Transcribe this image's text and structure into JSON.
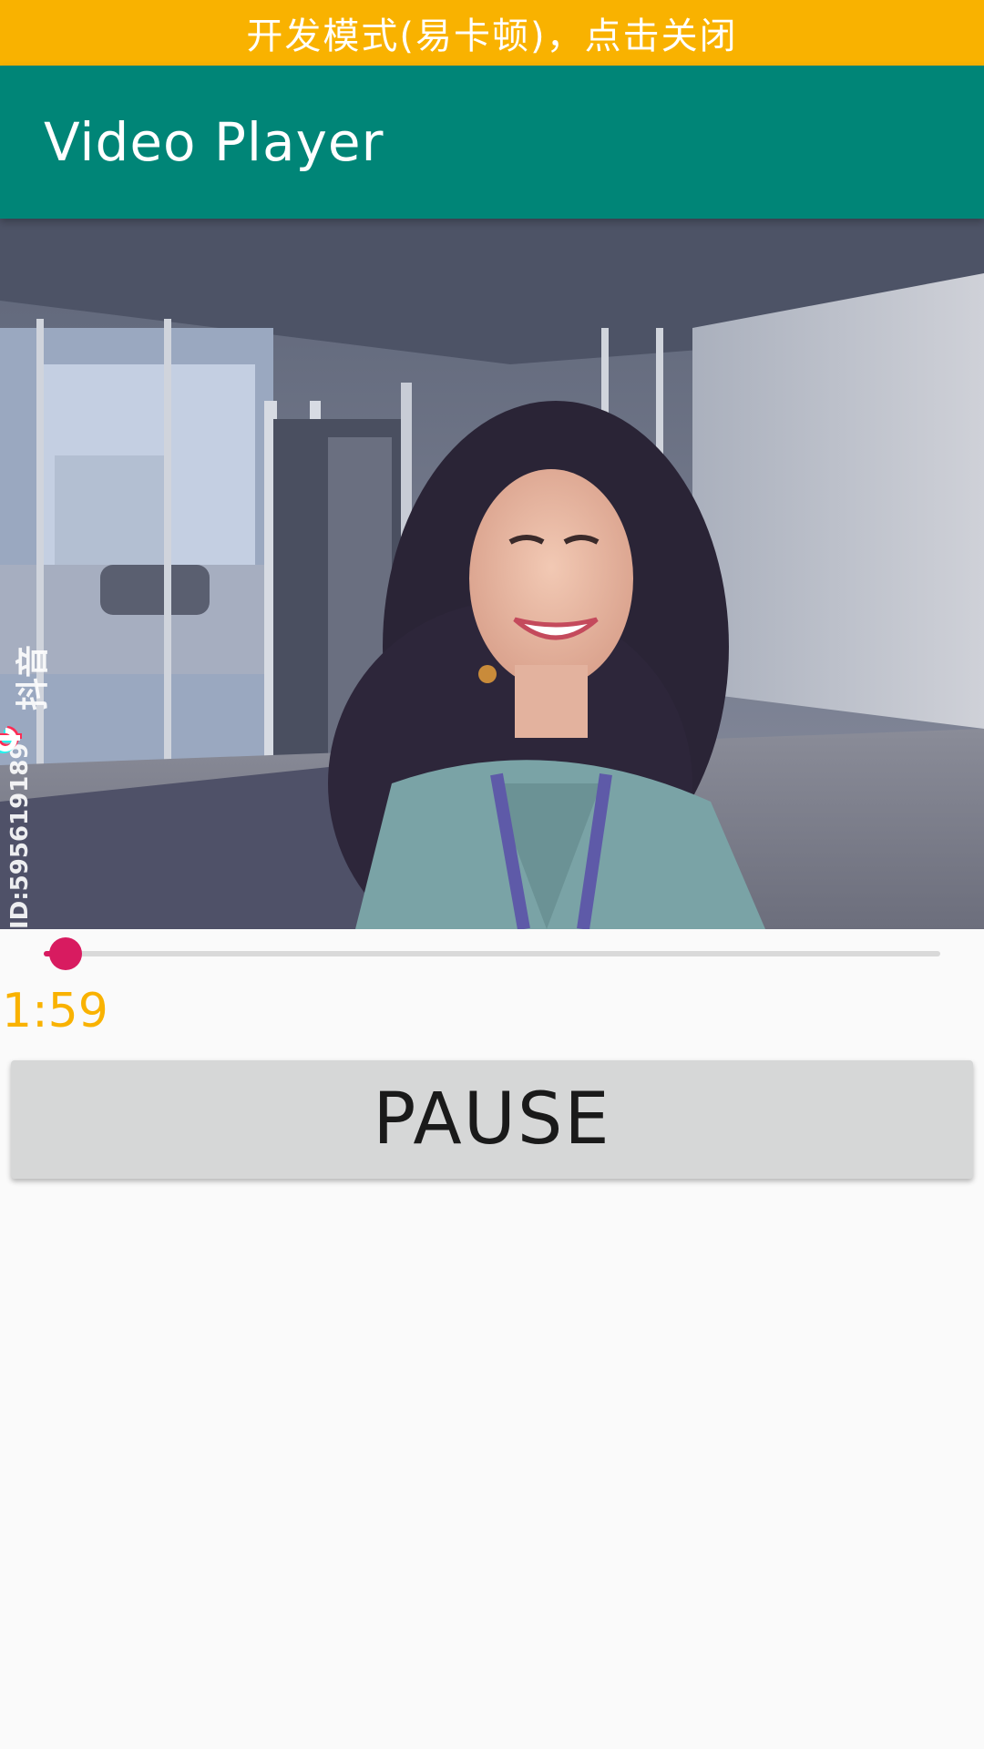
{
  "banner": {
    "text": "开发模式(易卡顿)，点击关闭",
    "color": "#f9b200"
  },
  "app_bar": {
    "title": "Video Player",
    "color": "#008577"
  },
  "video": {
    "watermark_app": "抖音",
    "watermark_id": "ID:595619189",
    "icon": "video-frame"
  },
  "seekbar": {
    "progress": 0.02,
    "accent_color": "#d81b60"
  },
  "time": {
    "elapsed": "1:59",
    "color": "#f9b200"
  },
  "controls": {
    "pause_label": "PAUSE"
  }
}
